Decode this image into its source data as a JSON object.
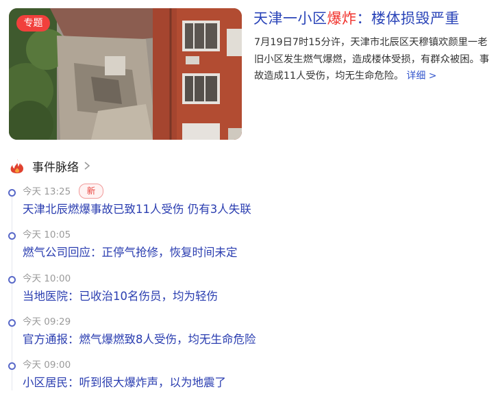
{
  "card": {
    "badge": "专题",
    "headline_pre": "天津一小区",
    "headline_highlight": "爆炸",
    "headline_post": "：楼体损毁严重",
    "summary": "7月19日7时15分许，天津市北辰区天穆镇欢颜里一老旧小区发生燃气爆燃，造成楼体受损，有群众被困。事故造成11人受伤，均无生命危险。",
    "more_label": "详细 >"
  },
  "timeline": {
    "title": "事件脉络",
    "new_label": "新",
    "items": [
      {
        "time": "今天 13:25",
        "text": "天津北辰燃爆事故已致11人受伤 仍有3人失联"
      },
      {
        "time": "今天 10:05",
        "text": "燃气公司回应：正停气抢修，恢复时间未定"
      },
      {
        "time": "今天 10:00",
        "text": "当地医院：已收治10名伤员，均为轻伤"
      },
      {
        "time": "今天 09:29",
        "text": "官方通报：燃气爆燃致8人受伤，均无生命危险"
      },
      {
        "time": "今天 09:00",
        "text": "小区居民：听到很大爆炸声，以为地震了"
      }
    ]
  },
  "colors": {
    "headline_blue": "#2a44b8",
    "headline_red": "#f0302a",
    "timeline_text": "#2a3db0",
    "badge_red": "#f1403c"
  },
  "icons": {
    "header": "fire-icon",
    "chevron": "chevron-right-icon"
  }
}
